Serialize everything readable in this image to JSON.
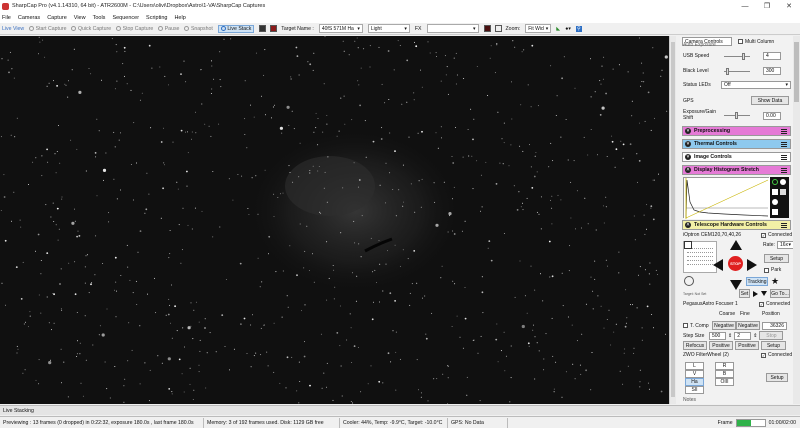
{
  "titlebar": {
    "title": "SharpCap Pro (v4.1.14310, 64 bit) - ATR2600M - C:\\Users\\olivi\\Dropbox\\Astro\\1-VA\\SharpCap Captures",
    "minimize": "—",
    "maximize": "❐",
    "close": "✕"
  },
  "menu": [
    "File",
    "Cameras",
    "Capture",
    "View",
    "Tools",
    "Sequencer",
    "Scripting",
    "Help"
  ],
  "toolbar": {
    "live_view": "Live View",
    "start_capture": "Start Capture",
    "quick_capture": "Quick Capture",
    "stop_capture": "Stop Capture",
    "pause": "Pause",
    "snapshot": "Snapshot",
    "live_stack": "Live Stack",
    "target_name_label": "Target Name :",
    "target_name_value": "40fS 571M Ha",
    "frame_type": "Light",
    "fx_label": "FX",
    "zoom_label": "Zoom:",
    "zoom_value": "Fit Wid"
  },
  "panel": {
    "tab_camera_controls": "Camera Controls",
    "tab_multi_column": "Multi Column",
    "auto_exposure": "Auto Exposure",
    "usb_speed_label": "USB Speed",
    "usb_speed_value": "4",
    "black_level_label": "Black Level",
    "black_level_value": "300",
    "status_leds_label": "Status LEDs",
    "status_leds_value": "Off",
    "gps_label": "GPS",
    "show_data": "Show Data",
    "exposure_gain_label": "Exposure/Gain Shift",
    "exposure_gain_value": "0.00",
    "preprocessing": "Preprocessing",
    "thermal_controls": "Thermal Controls",
    "image_controls": "Image Controls",
    "histogram_stretch": "Display Histogram Stretch",
    "telescope_controls": "Telescope Hardware Controls",
    "mount_name": "iOptron CEM120,70,40,26",
    "connected": "Connected",
    "rate_label": "Rate:",
    "rate_value": "16x",
    "setup": "Setup",
    "park": "Park",
    "stop": "STOP",
    "tracking": "Tracking",
    "target_row": "Target: Not Set",
    "set": "Set",
    "goto": "Go To...",
    "focuser_name": "PegasusAstro Focuser 1",
    "coarse": "Coarse",
    "fine": "Fine",
    "position": "Position",
    "t_comp": "T. Comp",
    "negative": "Negative",
    "position_value": "36326",
    "step_size_label": "Step Size",
    "step_coarse": "500",
    "step_fine": "2",
    "stop_btn": "Stop",
    "refocus": "Refocus",
    "positive": "Positive",
    "filterwheel_name": "ZWO FilterWheel (2)",
    "filters": [
      "L",
      "R",
      "V",
      "B",
      "Ha",
      "OIII",
      "SII",
      ""
    ],
    "notes": "Notes"
  },
  "status": {
    "live_stacking_tab": "Live Stacking",
    "previewing": "Previewing : 13 frames (0 dropped) in 0:22:32, exposure 180.0s , last frame 180.0s",
    "memory": "Memory: 3 of 192 frames used. Disk: 1129 GB free",
    "cooler": "Cooler: 44%, Temp: -9.9°C, Target: -10.0°C",
    "gps": "GPS: No Data",
    "frame_label": "Frame",
    "frame_time": "01:00/02:00",
    "frame_progress": 0.5
  },
  "colors": {
    "preprocessing_header": "#e57ad6",
    "thermal_header": "#8ec9ee",
    "image_header": "#ffffff",
    "histogram_header": "#e57ad6",
    "telescope_header": "#f3f0a6",
    "stop_button": "#e02020",
    "progress_fill": "#2fb24a"
  }
}
